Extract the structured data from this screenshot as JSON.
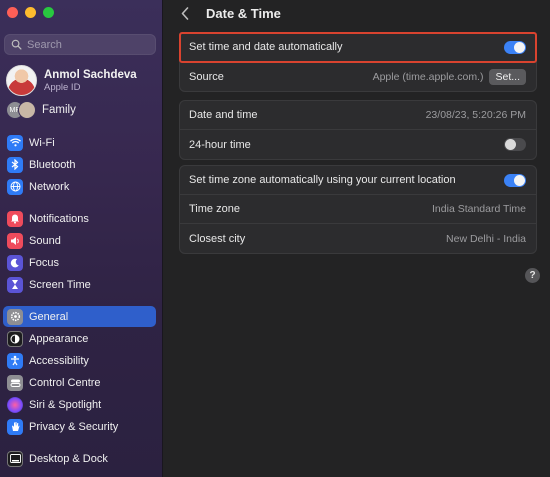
{
  "sidebar": {
    "search_placeholder": "Search",
    "account": {
      "name": "Anmol Sachdeva",
      "subtitle": "Apple ID"
    },
    "family": {
      "initials": "MR",
      "label": "Family"
    },
    "items": [
      {
        "label": "Wi-Fi",
        "icon": "wifi-icon",
        "color": "#2f7bf6"
      },
      {
        "label": "Bluetooth",
        "icon": "bluetooth-icon",
        "color": "#2f7bf6"
      },
      {
        "label": "Network",
        "icon": "globe-icon",
        "color": "#2f7bf6"
      },
      {
        "label": "Notifications",
        "icon": "bell-icon",
        "color": "#ef4b5c"
      },
      {
        "label": "Sound",
        "icon": "speaker-icon",
        "color": "#ef4b5c"
      },
      {
        "label": "Focus",
        "icon": "moon-icon",
        "color": "#5b54d6"
      },
      {
        "label": "Screen Time",
        "icon": "hourglass-icon",
        "color": "#5b54d6"
      },
      {
        "label": "General",
        "icon": "gear-icon",
        "color": "#8e8e93"
      },
      {
        "label": "Appearance",
        "icon": "appearance-icon",
        "color": "#1c1c1e"
      },
      {
        "label": "Accessibility",
        "icon": "accessibility-icon",
        "color": "#2f7bf6"
      },
      {
        "label": "Control Centre",
        "icon": "control-centre-icon",
        "color": "#8e8e93"
      },
      {
        "label": "Siri & Spotlight",
        "icon": "siri-icon",
        "color": "#b34fd1"
      },
      {
        "label": "Privacy & Security",
        "icon": "hand-icon",
        "color": "#2f7bf6"
      },
      {
        "label": "Desktop & Dock",
        "icon": "dock-icon",
        "color": "#1c1c1e"
      }
    ],
    "active": "General"
  },
  "header": {
    "title": "Date & Time"
  },
  "settings": {
    "auto_time_label": "Set time and date automatically",
    "auto_time_on": true,
    "source_label": "Source",
    "source_value": "Apple (time.apple.com.)",
    "set_button": "Set...",
    "date_time_label": "Date and time",
    "date_time_value": "23/08/23, 5:20:26 PM",
    "hour24_label": "24-hour time",
    "hour24_on": false,
    "auto_tz_label": "Set time zone automatically using your current location",
    "auto_tz_on": true,
    "timezone_label": "Time zone",
    "timezone_value": "India Standard Time",
    "closest_city_label": "Closest city",
    "closest_city_value": "New Delhi - India"
  },
  "help": "?",
  "colors": {
    "accent": "#2f5fcb",
    "toggle_on": "#3b82f6",
    "highlight": "#d9432f"
  }
}
